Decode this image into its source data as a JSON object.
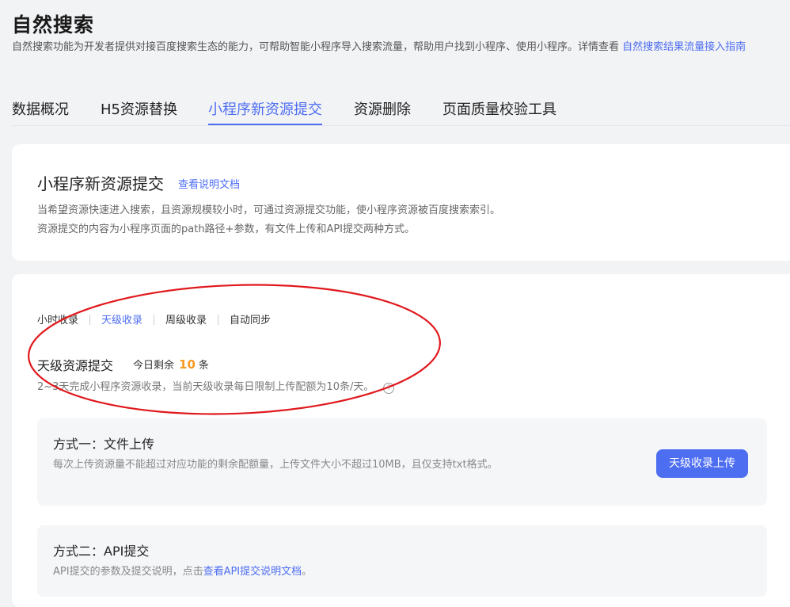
{
  "page": {
    "title": "自然搜索",
    "description": "自然搜索功能为开发者提供对接百度搜索生态的能力，可帮助智能小程序导入搜索流量，帮助用户找到小程序、使用小程序。详情查看",
    "description_link": "自然搜索结果流量接入指南"
  },
  "tabs": [
    {
      "label": "数据概况"
    },
    {
      "label": "H5资源替换"
    },
    {
      "label": "小程序新资源提交",
      "active": true
    },
    {
      "label": "资源删除"
    },
    {
      "label": "页面质量校验工具"
    }
  ],
  "intro_card": {
    "title": "小程序新资源提交",
    "doc_link": "查看说明文档",
    "lines": [
      "当希望资源快速进入搜索，且资源规模较小时，可通过资源提交功能，使小程序资源被百度搜索索引。",
      "资源提交的内容为小程序页面的path路径+参数，有文件上传和API提交两种方式。"
    ]
  },
  "submit_card": {
    "subtabs": [
      {
        "label": "小时收录"
      },
      {
        "label": "天级收录",
        "active": true
      },
      {
        "label": "周级收录"
      },
      {
        "label": "自动同步"
      }
    ],
    "section_title": "天级资源提交",
    "remaining_prefix": "今日剩余",
    "remaining_count": "10",
    "remaining_suffix": "条",
    "section_desc": "2~3天完成小程序资源收录，当前天级收录每日限制上传配额为10条/天。",
    "help_icon": "question-circle-icon",
    "methods": [
      {
        "title": "方式一：文件上传",
        "desc": "每次上传资源量不能超过对应功能的剩余配额量，上传文件大小不超过10MB，且仅支持txt格式。",
        "button": "天级收录上传"
      },
      {
        "title": "方式二：API提交",
        "desc_prefix": "API提交的参数及提交说明，点击",
        "desc_link": "查看API提交说明文档",
        "desc_suffix": "。"
      }
    ]
  },
  "colors": {
    "accent": "#4e6ef2",
    "highlight": "#f59a23",
    "annotation": "#e0191d",
    "background": "#f2f3f5"
  }
}
